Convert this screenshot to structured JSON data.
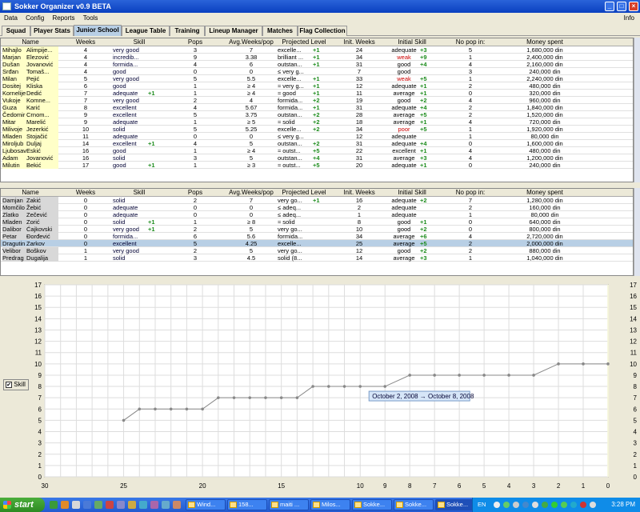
{
  "window": {
    "title": "Sokker Organizer v0.9 BETA"
  },
  "menu": {
    "items": [
      "Data",
      "Config",
      "Reports",
      "Tools"
    ],
    "info": "Info"
  },
  "tabs": [
    "Squad",
    "Player Stats",
    "Junior School",
    "League Table",
    "Training",
    "Lineup Manager",
    "Matches",
    "Flag Collection"
  ],
  "active_tab": "Junior School",
  "columns": [
    "Name",
    "Weeks",
    "Skill",
    "Pops",
    "Avg.Weeks/pop",
    "Projected Level",
    "Init. Weeks",
    "Initial Skill",
    "No pop in:",
    "Money spent"
  ],
  "top_rows": [
    [
      "Mihajlo",
      "Alimpije...",
      "4",
      "very good",
      "",
      "3",
      "7",
      "excelle...",
      "+1",
      "24",
      "adequate",
      "+3",
      "5",
      "1,680,000 din"
    ],
    [
      "Marjan",
      "Elezović",
      "4",
      "incredib...",
      "",
      "9",
      "3.38",
      "brilliant ...",
      "+1",
      "34",
      "weak",
      "+9",
      "1",
      "2,400,000 din"
    ],
    [
      "Dušan",
      "Jovanović",
      "4",
      "formida...",
      "",
      "4",
      "6",
      "outstan...",
      "+1",
      "31",
      "good",
      "+4",
      "4",
      "2,160,000 din"
    ],
    [
      "Srđan",
      "Tomaš...",
      "4",
      "good",
      "",
      "0",
      "0",
      "≤ very g...",
      "",
      "7",
      "good",
      "",
      "3",
      "240,000 din"
    ],
    [
      "Milan",
      "Pejić",
      "5",
      "very good",
      "",
      "5",
      "5.5",
      "excelle...",
      "+1",
      "33",
      "weak",
      "+5",
      "1",
      "2,240,000 din"
    ],
    [
      "Dositej",
      "Kliska",
      "6",
      "good",
      "",
      "1",
      "≥ 4",
      "≈ very g...",
      "+1",
      "12",
      "adequate",
      "+1",
      "2",
      "480,000 din"
    ],
    [
      "Kornelije",
      "Dedić",
      "7",
      "adequate",
      "+1",
      "1",
      "≥ 4",
      "≈ good",
      "+1",
      "11",
      "average",
      "+1",
      "0",
      "320,000 din"
    ],
    [
      "Vukoje",
      "Komne...",
      "7",
      "very good",
      "",
      "2",
      "4",
      "formida...",
      "+2",
      "19",
      "good",
      "+2",
      "4",
      "960,000 din"
    ],
    [
      "Guza",
      "Karić",
      "8",
      "excellent",
      "",
      "4",
      "5.67",
      "formida...",
      "+1",
      "31",
      "adequate",
      "+4",
      "2",
      "1,840,000 din"
    ],
    [
      "Čedomir",
      "Crnom...",
      "9",
      "excellent",
      "",
      "5",
      "3.75",
      "outstan...",
      "+2",
      "28",
      "average",
      "+5",
      "2",
      "1,520,000 din"
    ],
    [
      "Mitar",
      "Marelić",
      "9",
      "adequate",
      "",
      "1",
      "≥ 5",
      "≈ solid",
      "+2",
      "18",
      "average",
      "+1",
      "4",
      "720,000 din"
    ],
    [
      "Milivoje",
      "Jezerkić",
      "10",
      "solid",
      "",
      "5",
      "5.25",
      "excelle...",
      "+2",
      "34",
      "poor",
      "+5",
      "1",
      "1,920,000 din"
    ],
    [
      "Mladen",
      "Stojačić",
      "11",
      "adequate",
      "",
      "0",
      "0",
      "≤ very g...",
      "",
      "12",
      "adequate",
      "",
      "1",
      "80,000 din"
    ],
    [
      "Miroljub",
      "Duljaj",
      "14",
      "excellent",
      "+1",
      "4",
      "5",
      "outstan...",
      "+2",
      "31",
      "adequate",
      "+4",
      "0",
      "1,600,000 din"
    ],
    [
      "Ljubosav",
      "Eskić",
      "16",
      "good",
      "",
      "1",
      "≥ 4",
      "≈ outst...",
      "+5",
      "22",
      "excellent",
      "+1",
      "4",
      "480,000 din"
    ],
    [
      "Adam",
      "Jovanović",
      "16",
      "solid",
      "",
      "3",
      "5",
      "outstan...",
      "+4",
      "31",
      "average",
      "+3",
      "4",
      "1,200,000 din"
    ],
    [
      "Milutin",
      "Bekić",
      "17",
      "good",
      "+1",
      "1",
      "≥ 3",
      "≈ outst...",
      "+5",
      "20",
      "adequate",
      "+1",
      "0",
      "240,000 din"
    ]
  ],
  "bottom_rows": [
    [
      "Damjan",
      "Zakić",
      "0",
      "solid",
      "",
      "2",
      "7",
      "very go...",
      "+1",
      "16",
      "adequate",
      "+2",
      "7",
      "1,280,000 din"
    ],
    [
      "Momčilo",
      "Žebić",
      "0",
      "adequate",
      "",
      "0",
      "0",
      "≤ adeq...",
      "",
      "2",
      "adequate",
      "",
      "2",
      "160,000 din"
    ],
    [
      "Zlatko",
      "Zečević",
      "0",
      "adequate",
      "",
      "0",
      "0",
      "≤ adeq...",
      "",
      "1",
      "adequate",
      "",
      "1",
      "80,000 din"
    ],
    [
      "Mladen",
      "Zorić",
      "0",
      "solid",
      "+1",
      "1",
      "≥ 8",
      "≈ solid",
      "",
      "8",
      "good",
      "+1",
      "0",
      "640,000 din"
    ],
    [
      "Dalibor",
      "Ćajkovski",
      "0",
      "very good",
      "+1",
      "2",
      "5",
      "very go...",
      "",
      "10",
      "good",
      "+2",
      "0",
      "800,000 din"
    ],
    [
      "Petar",
      "Đorđević",
      "0",
      "formida...",
      "",
      "6",
      "5.6",
      "formida...",
      "",
      "34",
      "average",
      "+6",
      "4",
      "2,720,000 din"
    ],
    [
      "Dragutin",
      "Zarkov",
      "0",
      "excellent",
      "",
      "5",
      "4.25",
      "excelle...",
      "",
      "25",
      "average",
      "+5",
      "2",
      "2,000,000 din"
    ],
    [
      "Velibor",
      "Boškov",
      "1",
      "very good",
      "",
      "2",
      "5",
      "very go...",
      "",
      "12",
      "good",
      "+2",
      "2",
      "880,000 din"
    ],
    [
      "Predrag",
      "Dugalija",
      "1",
      "solid",
      "",
      "3",
      "4.5",
      "solid (8...",
      "",
      "14",
      "average",
      "+3",
      "1",
      "1,040,000 din"
    ]
  ],
  "selected_bottom_row": 6,
  "chart_data": {
    "type": "line",
    "series": [
      {
        "name": "Skill",
        "points": [
          [
            25,
            5
          ],
          [
            24,
            6
          ],
          [
            23,
            6
          ],
          [
            22,
            6
          ],
          [
            21,
            6
          ],
          [
            20,
            6
          ],
          [
            19,
            7
          ],
          [
            18,
            7
          ],
          [
            17,
            7
          ],
          [
            16,
            7
          ],
          [
            15,
            7
          ],
          [
            14,
            7
          ],
          [
            13,
            8
          ],
          [
            12,
            8
          ],
          [
            11,
            8
          ],
          [
            10,
            8
          ],
          [
            9,
            8
          ],
          [
            8,
            9
          ],
          [
            7,
            9
          ],
          [
            6,
            9
          ],
          [
            5,
            9
          ],
          [
            4,
            9
          ],
          [
            3,
            9
          ],
          [
            2,
            10
          ],
          [
            1,
            10
          ],
          [
            0,
            10
          ]
        ]
      }
    ],
    "x_ticks": [
      "30",
      "25",
      "20",
      "15",
      "10",
      "9",
      "8",
      "7",
      "6",
      "5",
      "4",
      "3",
      "2",
      "1",
      "0"
    ],
    "y_ticks": [
      "0",
      "1",
      "2",
      "3",
      "4",
      "5",
      "6",
      "7",
      "8",
      "9",
      "10",
      "11",
      "12",
      "13",
      "14",
      "15",
      "16",
      "17"
    ],
    "ylim": [
      0,
      17
    ],
    "annotation": "October 2, 2008 → October 8, 2008",
    "grid": true,
    "line_color": "#888888"
  },
  "legend": {
    "label": "Skill",
    "checked": "✔"
  },
  "taskbar": {
    "start": "start",
    "buttons": [
      "Wind...",
      "158...",
      "maiti ...",
      "Milos...",
      "Sokke...",
      "Sokke...",
      "Sokke..."
    ],
    "lang": "EN",
    "clock": "3:28 PM"
  }
}
